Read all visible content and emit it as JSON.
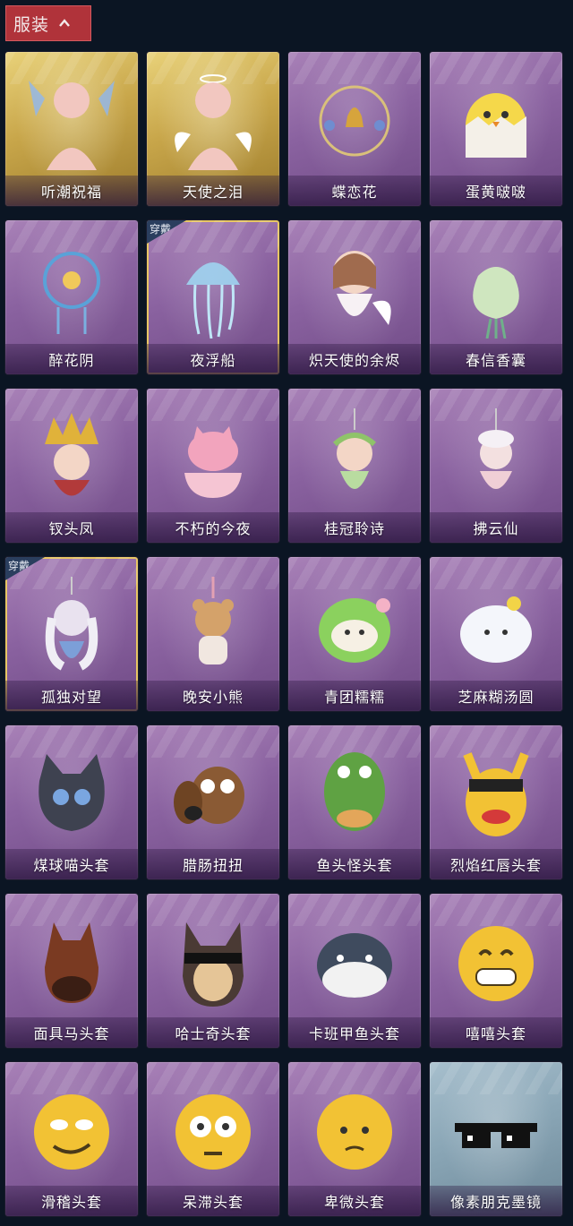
{
  "header": {
    "title": "服装"
  },
  "equipped_badge": "穿戴",
  "items": [
    {
      "name": "听潮祝福",
      "style": "gold",
      "icon": "mannequin-butterfly-wings-icon",
      "equipped": false
    },
    {
      "name": "天使之泪",
      "style": "gold",
      "icon": "mannequin-angel-wings-halo-icon",
      "equipped": false
    },
    {
      "name": "蝶恋花",
      "style": "purple",
      "icon": "bell-wreath-charm-icon",
      "equipped": false
    },
    {
      "name": "蛋黄啵啵",
      "style": "purple",
      "icon": "chick-in-eggshell-icon",
      "equipped": false
    },
    {
      "name": "醉花阴",
      "style": "purple",
      "icon": "floral-dreamcatcher-icon",
      "equipped": false
    },
    {
      "name": "夜浮船",
      "style": "purple",
      "icon": "jellyfish-icon",
      "equipped": true
    },
    {
      "name": "炽天使的余烬",
      "style": "purple",
      "icon": "angel-girl-figurine-icon",
      "equipped": false
    },
    {
      "name": "春信香囊",
      "style": "purple",
      "icon": "sachet-pouch-icon",
      "equipped": false
    },
    {
      "name": "钗头凤",
      "style": "purple",
      "icon": "phoenix-crown-figurine-icon",
      "equipped": false
    },
    {
      "name": "不朽的今夜",
      "style": "purple",
      "icon": "pink-cat-cup-icon",
      "equipped": false
    },
    {
      "name": "桂冠聆诗",
      "style": "purple",
      "icon": "laurel-fairy-charm-icon",
      "equipped": false
    },
    {
      "name": "拂云仙",
      "style": "purple",
      "icon": "cloud-fairy-charm-icon",
      "equipped": false
    },
    {
      "name": "孤独对望",
      "style": "purple",
      "icon": "silver-hair-doll-charm-icon",
      "equipped": true
    },
    {
      "name": "晚安小熊",
      "style": "purple",
      "icon": "teddy-bear-charm-icon",
      "equipped": false
    },
    {
      "name": "青团糯糯",
      "style": "purple",
      "icon": "green-dumpling-icon",
      "equipped": false
    },
    {
      "name": "芝麻糊汤圆",
      "style": "purple",
      "icon": "white-dumpling-icon",
      "equipped": false
    },
    {
      "name": "煤球喵头套",
      "style": "purple",
      "icon": "black-cat-mask-icon",
      "equipped": false
    },
    {
      "name": "腊肠扭扭",
      "style": "purple",
      "icon": "dachshund-mask-icon",
      "equipped": false
    },
    {
      "name": "鱼头怪头套",
      "style": "purple",
      "icon": "fish-head-mask-icon",
      "equipped": false
    },
    {
      "name": "烈焰红唇头套",
      "style": "purple",
      "icon": "yellow-lips-mask-icon",
      "equipped": false
    },
    {
      "name": "面具马头套",
      "style": "purple",
      "icon": "horse-mask-icon",
      "equipped": false
    },
    {
      "name": "哈士奇头套",
      "style": "purple",
      "icon": "husky-mask-icon",
      "equipped": false
    },
    {
      "name": "卡班甲鱼头套",
      "style": "purple",
      "icon": "penguin-fish-mask-icon",
      "equipped": false
    },
    {
      "name": "嘻嘻头套",
      "style": "purple",
      "icon": "grin-emoji-mask-icon",
      "equipped": false
    },
    {
      "name": "滑稽头套",
      "style": "purple",
      "icon": "smirk-emoji-mask-icon",
      "equipped": false
    },
    {
      "name": "呆滞头套",
      "style": "purple",
      "icon": "stare-emoji-mask-icon",
      "equipped": false
    },
    {
      "name": "卑微头套",
      "style": "purple",
      "icon": "humble-emoji-mask-icon",
      "equipped": false
    },
    {
      "name": "像素朋克墨镜",
      "style": "blue",
      "icon": "pixel-sunglasses-icon",
      "equipped": false
    }
  ]
}
